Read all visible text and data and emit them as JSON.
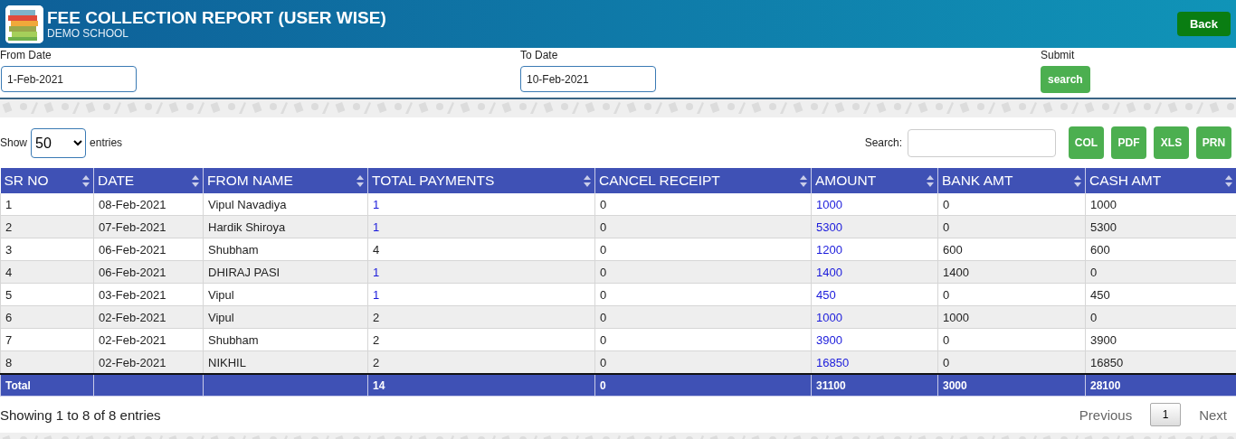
{
  "header": {
    "title": "FEE COLLECTION REPORT (USER WISE)",
    "subtitle": "DEMO SCHOOL",
    "back_button": "Back"
  },
  "filters": {
    "from_label": "From Date",
    "from_value": "1-Feb-2021",
    "to_label": "To Date",
    "to_value": "10-Feb-2021",
    "submit_label": "Submit",
    "submit_button": "search"
  },
  "table_controls": {
    "show_label": "Show",
    "entries_value": "50",
    "entries_label": "entries",
    "search_label": "Search:",
    "export_buttons": [
      "COL",
      "PDF",
      "XLS",
      "PRN"
    ]
  },
  "table": {
    "columns": [
      {
        "label": "SR NO",
        "kind": "text"
      },
      {
        "label": "DATE",
        "kind": "text"
      },
      {
        "label": "FROM NAME",
        "kind": "text"
      },
      {
        "label": "TOTAL PAYMENTS",
        "kind": "payments"
      },
      {
        "label": "CANCEL RECEIPT",
        "kind": "text"
      },
      {
        "label": "AMOUNT",
        "kind": "link"
      },
      {
        "label": "BANK AMT",
        "kind": "text"
      },
      {
        "label": "CASH AMT",
        "kind": "text"
      }
    ],
    "rows": [
      {
        "cells": [
          "1",
          "08-Feb-2021",
          "Vipul Navadiya",
          "1",
          "0",
          "1000",
          "0",
          "1000"
        ],
        "payments_link": true
      },
      {
        "cells": [
          "2",
          "07-Feb-2021",
          "Hardik Shiroya",
          "1",
          "0",
          "5300",
          "0",
          "5300"
        ],
        "payments_link": true
      },
      {
        "cells": [
          "3",
          "06-Feb-2021",
          "Shubham",
          "4",
          "0",
          "1200",
          "600",
          "600"
        ],
        "payments_link": false
      },
      {
        "cells": [
          "4",
          "06-Feb-2021",
          "DHIRAJ PASI",
          "1",
          "0",
          "1400",
          "1400",
          "0"
        ],
        "payments_link": true
      },
      {
        "cells": [
          "5",
          "03-Feb-2021",
          "Vipul",
          "1",
          "0",
          "450",
          "0",
          "450"
        ],
        "payments_link": true
      },
      {
        "cells": [
          "6",
          "02-Feb-2021",
          "Vipul",
          "2",
          "0",
          "1000",
          "1000",
          "0"
        ],
        "payments_link": false
      },
      {
        "cells": [
          "7",
          "02-Feb-2021",
          "Shubham",
          "2",
          "0",
          "3900",
          "0",
          "3900"
        ],
        "payments_link": false
      },
      {
        "cells": [
          "8",
          "02-Feb-2021",
          "NIKHIL",
          "2",
          "0",
          "16850",
          "0",
          "16850"
        ],
        "payments_link": false
      }
    ],
    "total": {
      "label": "Total",
      "cells": [
        "14",
        "0",
        "31100",
        "3000",
        "28100"
      ]
    }
  },
  "footer": {
    "info": "Showing 1 to 8 of 8 entries",
    "previous": "Previous",
    "page": "1",
    "next": "Next"
  }
}
